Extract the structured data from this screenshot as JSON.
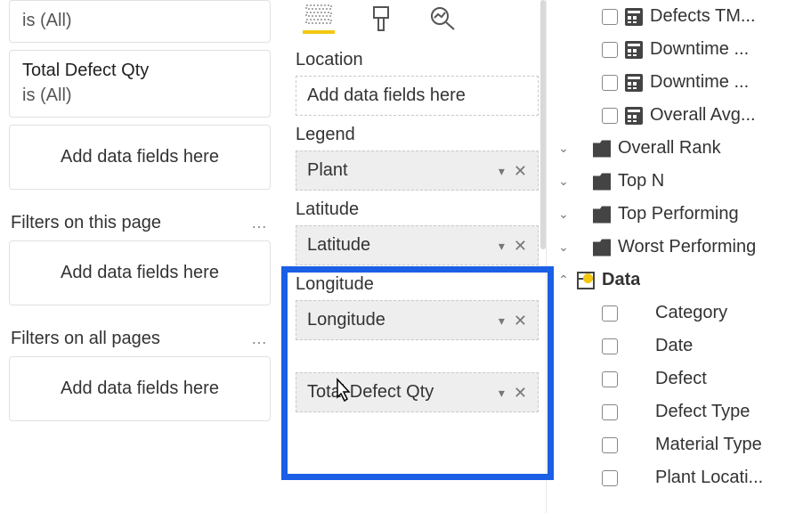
{
  "filters": {
    "card1_sub": "is (All)",
    "card2_title": "Total Defect Qty",
    "card2_sub": "is (All)",
    "dropzone_text": "Add data fields here",
    "page_header": "Filters on this page",
    "all_header": "Filters on all pages"
  },
  "wells": {
    "add_placeholder": "Add data fields here",
    "location_label": "Location",
    "legend_label": "Legend",
    "legend_value": "Plant",
    "latitude_label": "Latitude",
    "latitude_value": "Latitude",
    "longitude_label": "Longitude",
    "longitude_value": "Longitude",
    "size_value": "Total Defect Qty"
  },
  "fields": {
    "m1": "Defects TM...",
    "m2": "Downtime ...",
    "m3": "Downtime ...",
    "m4": "Overall Avg...",
    "f1": "Overall Rank",
    "f2": "Top N",
    "f3": "Top Performing",
    "f4": "Worst Performing",
    "table": "Data",
    "c1": "Category",
    "c2": "Date",
    "c3": "Defect",
    "c4": "Defect Type",
    "c5": "Material Type",
    "c6": "Plant Locati..."
  }
}
